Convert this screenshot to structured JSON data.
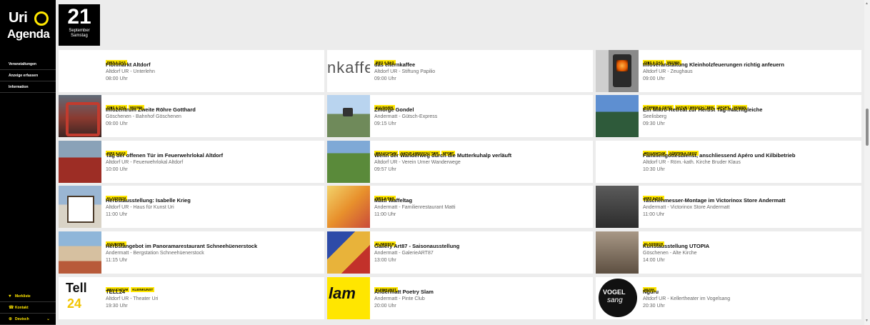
{
  "logo": {
    "line1": "Uri",
    "line2": "Agenda"
  },
  "date": {
    "day": "21",
    "month": "September",
    "weekday": "Samstag"
  },
  "nav": [
    "Veranstaltungen",
    "Anzeige erfassen",
    "Information"
  ],
  "sidebar_bottom": [
    {
      "icon": "heart-icon",
      "label": "Merkliste"
    },
    {
      "icon": "phone-icon",
      "label": "Kontakt"
    },
    {
      "icon": "globe-icon",
      "label": "Deutsch"
    }
  ],
  "colors": {
    "accent": "#ffe600",
    "sidebar": "#000000",
    "page_bg": "#ececec"
  },
  "events": [
    [
      {
        "thumb": "blank",
        "tags": [
          "Dies & Das"
        ],
        "title": "Flohmarkt Altdorf",
        "location": "Altdorf UR - Unterlehn",
        "time": "08:00 Uhr"
      },
      {
        "thumb": "kaffee",
        "thumb_text": "nkaffe",
        "tags": [
          "Dies & Das"
        ],
        "title": "das elternkaffee",
        "location": "Altdorf UR - Stiftung Papilio",
        "time": "09:00 Uhr"
      },
      {
        "thumb": "oven",
        "tags": [
          "Dies & Das",
          "Wissen"
        ],
        "title": "Infoveranstaltung Kleinholzfeuerungen richtig anfeuern",
        "location": "Altdorf UR - Zeughaus",
        "time": "09:00 Uhr"
      }
    ],
    [
      {
        "thumb": "tunnel",
        "tags": [
          "Dies & Das",
          "Wissen"
        ],
        "title": "Infozentrum Zweite Röhre Gotthard",
        "location": "Göschenen - Bahnhof Göschenen",
        "time": "09:00 Uhr"
      },
      {
        "thumb": "gondel",
        "tags": [
          "Kulinarik"
        ],
        "title": "Zmorge Gondel",
        "location": "Andermatt - Gütsch-Express",
        "time": "09:15 Uhr"
      },
      {
        "thumb": "mountain",
        "tags": [
          "Körper & Geist",
          "Natur / Mensch / Tier",
          "Sport",
          "Wissen"
        ],
        "title": "Ein Mikro-Retreat zur Herbst Tag-/Nachtgleiche",
        "location": "Seelisberg",
        "time": "09:30 Uhr"
      }
    ],
    [
      {
        "thumb": "fire-station",
        "tags": [
          "Dies & Das"
        ],
        "title": "Tag der offenen Tür im Feuerwehrlokal Altdorf",
        "location": "Altdorf UR - Feuerwehrlokal Altdorf",
        "time": "10:00 Uhr"
      },
      {
        "thumb": "meadow",
        "tags": [
          "Brauchtum",
          "Natur / Mensch / Tier",
          "Sport"
        ],
        "title": "Wenn der Wanderweg durch die Mutterkuhalp verläuft",
        "location": "Altdorf UR - Verein Urner Wanderwege",
        "time": "09:57 Uhr"
      },
      {
        "thumb": "blank",
        "tags": [
          "Brauchtum",
          "Körper & Geist"
        ],
        "title": "Familiengottesdienst, anschliessend Apéro und Kilbibetrieb",
        "location": "Altdorf UR - Röm.-kath. Kirche Bruder Klaus",
        "time": "10:30 Uhr"
      }
    ],
    [
      {
        "thumb": "house",
        "tags": [
          "Klassisch"
        ],
        "title": "Herbstausstellung: Isabelle Krieg",
        "location": "Altdorf UR - Haus für Kunst Uri",
        "time": "11:00 Uhr"
      },
      {
        "thumb": "waffle",
        "tags": [
          "Dies & Das"
        ],
        "title": "Matti Waffeltag",
        "location": "Andermatt - Familienrestaurant Matti",
        "time": "11:00 Uhr"
      },
      {
        "thumb": "knife",
        "tags": [
          "Dies & Das"
        ],
        "title": "Taschenmesser-Montage im Victorinox Store Andermatt",
        "location": "Andermatt - Victorinox Store Andermatt",
        "time": "11:00 Uhr"
      }
    ],
    [
      {
        "thumb": "food",
        "tags": [
          "Kulinarik"
        ],
        "title": "Herbstangebot im Panoramarestaurant Schneehüenerstock",
        "location": "Andermatt - Bergstation Schneehüenerstock",
        "time": "11:15 Uhr"
      },
      {
        "thumb": "gallery",
        "tags": [
          "Klassisch"
        ],
        "title": "Gallery Art87 - Saisonausstellung",
        "location": "Andermatt - GalerieART87",
        "time": "13:00 Uhr"
      },
      {
        "thumb": "utopia",
        "tags": [
          "Klassisch"
        ],
        "title": "Kunstausstellung UTOPIA",
        "location": "Göschenen - Alte Kirche",
        "time": "14:00 Uhr"
      }
    ],
    [
      {
        "thumb": "tell",
        "thumb_text": "Tell",
        "thumb_text2": "24",
        "tags": [
          "Brauchtum",
          "Kleinkunst"
        ],
        "title": "TELL24",
        "location": "Altdorf UR - Theater Uri",
        "time": "19:30 Uhr"
      },
      {
        "thumb": "slam",
        "thumb_text": "lam",
        "tags": [
          "Kleinkunst"
        ],
        "title": "Andermatt Poetry Slam",
        "location": "Andermatt - Pinte Club",
        "time": "20:00 Uhr"
      },
      {
        "thumb": "vogel",
        "thumb_text": "VOGEL",
        "thumb_text2": "sang",
        "tags": [
          "Musik"
        ],
        "title": "Nguru",
        "location": "Altdorf UR - Kellertheater im Vogelsang",
        "time": "20:30 Uhr"
      }
    ]
  ]
}
